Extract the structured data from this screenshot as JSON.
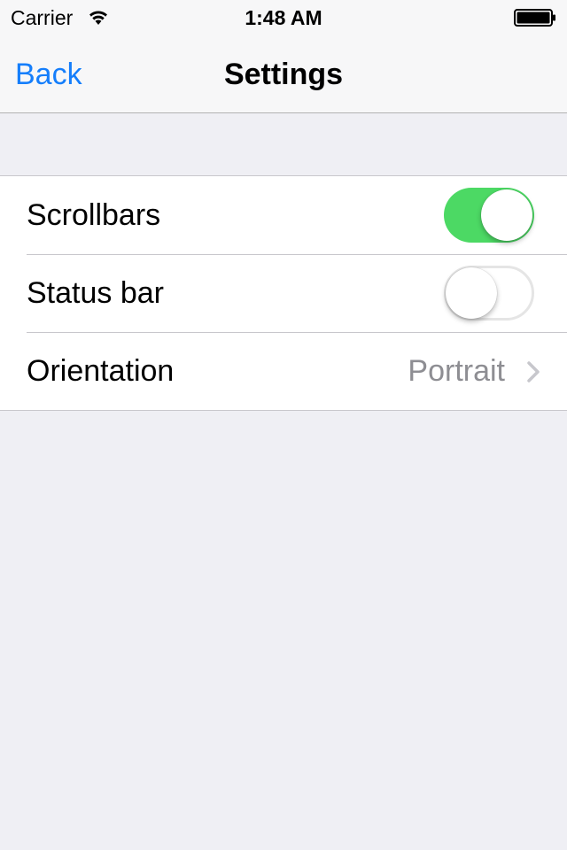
{
  "status_bar": {
    "carrier": "Carrier",
    "time": "1:48 AM",
    "wifi_icon": "wifi-icon",
    "battery_icon": "battery-icon"
  },
  "nav": {
    "back_label": "Back",
    "title": "Settings"
  },
  "settings": {
    "items": [
      {
        "label": "Scrollbars",
        "control": "toggle",
        "on": true
      },
      {
        "label": "Status bar",
        "control": "toggle",
        "on": false
      },
      {
        "label": "Orientation",
        "control": "disclosure",
        "value": "Portrait",
        "icon": "chevron-right-icon"
      }
    ]
  },
  "colors": {
    "accent": "#157efb",
    "toggle_on": "#4cd964",
    "background": "#efeff4",
    "detail_text": "#8e8e93"
  }
}
